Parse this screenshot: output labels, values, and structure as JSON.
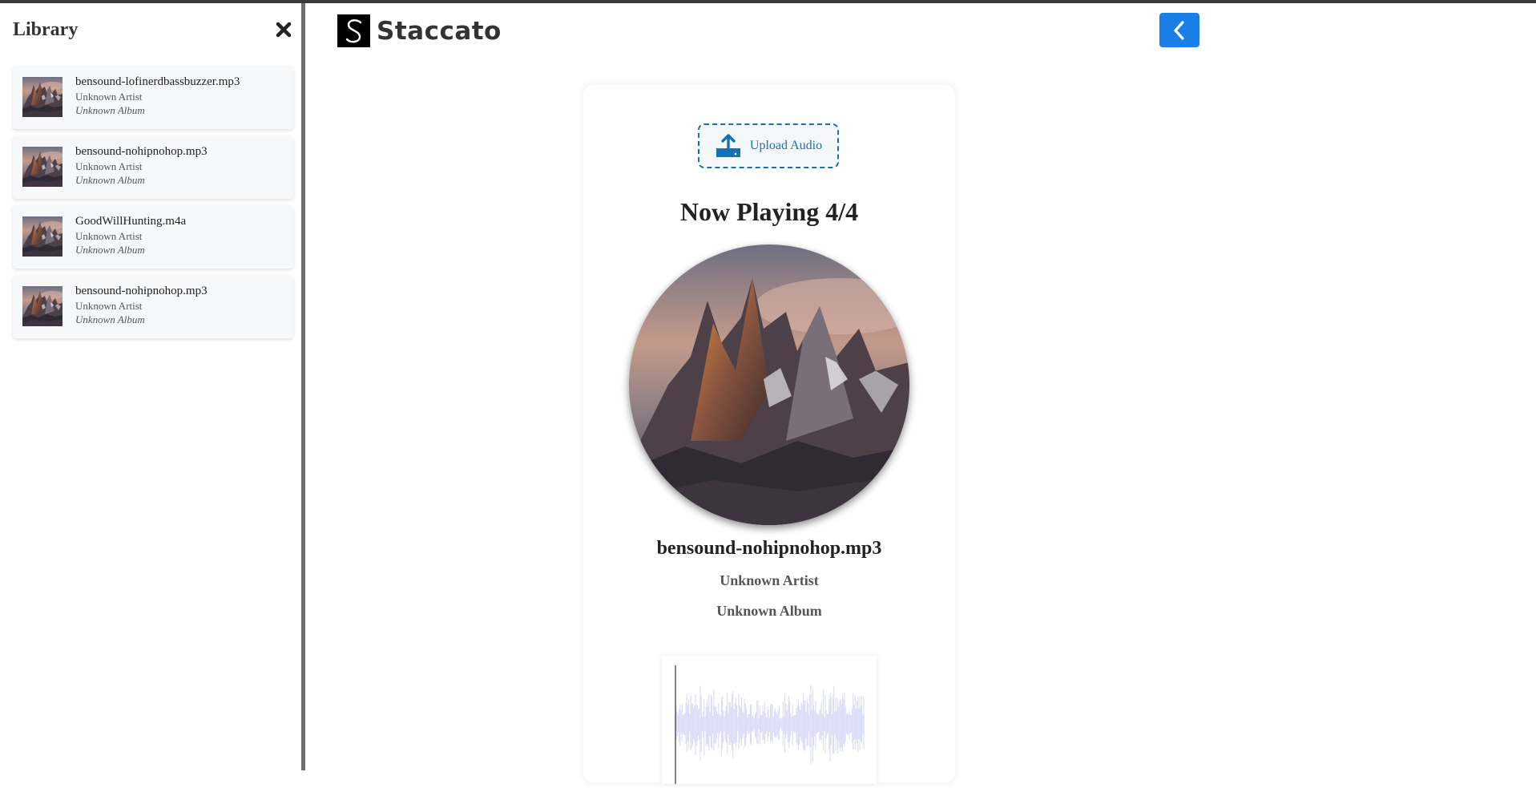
{
  "sidebar": {
    "title": "Library",
    "close_icon": "close-x-icon",
    "tracks": [
      {
        "name": "bensound-lofinerdbassbuzzer.mp3",
        "artist": "Unknown Artist",
        "album": "Unknown Album"
      },
      {
        "name": "bensound-nohipnohop.mp3",
        "artist": "Unknown Artist",
        "album": "Unknown Album"
      },
      {
        "name": "GoodWillHunting.m4a",
        "artist": "Unknown Artist",
        "album": "Unknown Album"
      },
      {
        "name": "bensound-nohipnohop.mp3",
        "artist": "Unknown Artist",
        "album": "Unknown Album"
      }
    ]
  },
  "header": {
    "logo_text": "Staccato",
    "logo_letter": "S",
    "back_icon": "chevron-left-icon"
  },
  "player": {
    "upload_label": "Upload Audio",
    "upload_icon": "upload-icon",
    "now_playing": "Now Playing 4/4",
    "song_title": "bensound-nohipnohop.mp3",
    "song_artist": "Unknown Artist",
    "song_album": "Unknown Album"
  },
  "colors": {
    "accent": "#1a7fe6",
    "upload": "#1272b8",
    "waveform": "#d6d9f7"
  }
}
